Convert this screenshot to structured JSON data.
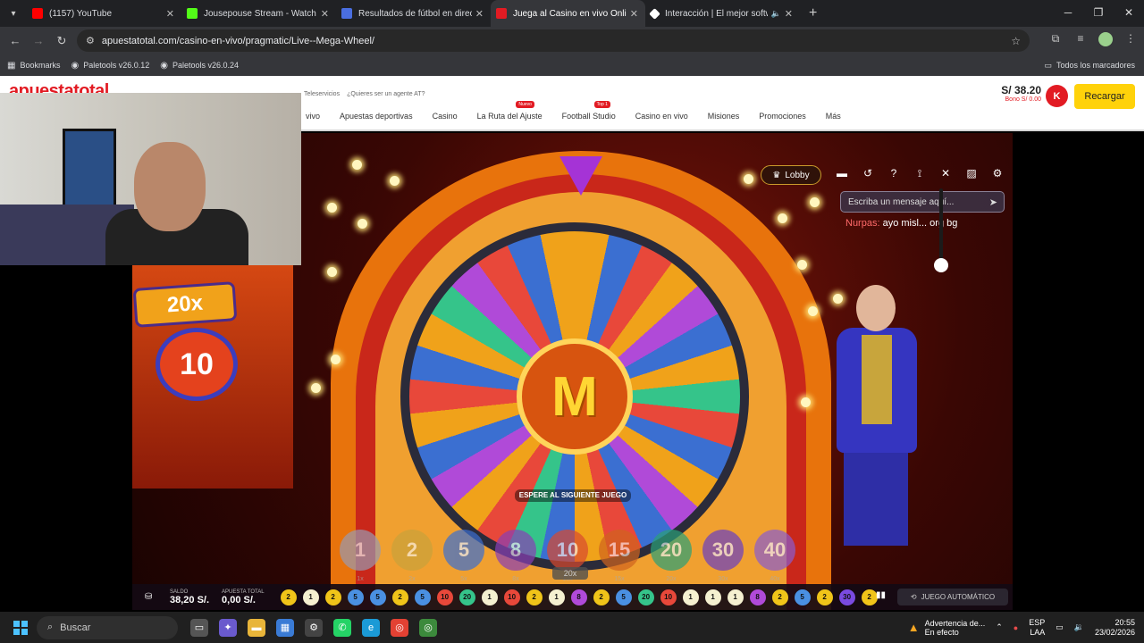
{
  "browser": {
    "tabs": [
      {
        "title": "(1157) YouTube",
        "color": "#ff0000",
        "active": false
      },
      {
        "title": "Jousepouse Stream - Watch Li...",
        "color": "#53fc18",
        "active": false
      },
      {
        "title": "Resultados de fútbol en directo",
        "color": "#4a6ee0",
        "active": false
      },
      {
        "title": "Juega al Casino en vivo Online",
        "color": "#e21b23",
        "active": true
      },
      {
        "title": "Interacción | El mejor softw...",
        "color": "#ffffff",
        "active": false
      }
    ],
    "url": "apuestatotal.com/casino-en-vivo/pragmatic/Live--Mega-Wheel/",
    "bookmarks": [
      "Bookmarks",
      "Paletools v26.0.12",
      "Paletools v26.0.24"
    ],
    "all_bookmarks": "Todos los marcadores"
  },
  "site": {
    "logo": "apuestatotal",
    "topline": [
      "Teleservicios",
      "¿Quieres ser un agente AT?"
    ],
    "nav": [
      {
        "label": "vivo",
        "badge": ""
      },
      {
        "label": "Apuestas deportivas",
        "badge": ""
      },
      {
        "label": "Casino",
        "badge": ""
      },
      {
        "label": "La Ruta del Ajuste",
        "badge": "Nuevo"
      },
      {
        "label": "Football Studio",
        "badge": "Top 1"
      },
      {
        "label": "Casino en vivo",
        "badge": ""
      },
      {
        "label": "Misiones",
        "badge": ""
      },
      {
        "label": "Promociones",
        "badge": ""
      },
      {
        "label": "Más",
        "badge": ""
      }
    ],
    "balance": "S/ 38.20",
    "bono": "Bono S/ 0.00",
    "avatar": "K",
    "recargar": "Recargar"
  },
  "game": {
    "lobby": "Lobby",
    "chat_placeholder": "Escriba un mensaje aquí...",
    "chat_user": "Nurpas:",
    "chat_text": "ayo misl... org bg",
    "status": "ESPERE AL SIGUIENTE JUEGO",
    "hub_letter": "M",
    "left_multiplier": "20x",
    "left_number": "10",
    "chips": [
      {
        "label": "1",
        "sub": "1x",
        "color": "#9a9ab0"
      },
      {
        "label": "2",
        "sub": "2x",
        "color": "#c9a23a"
      },
      {
        "label": "5",
        "sub": "5x",
        "color": "#3b6fd1"
      },
      {
        "label": "8",
        "sub": "8x",
        "color": "#8a3fb5"
      },
      {
        "label": "10",
        "sub": "10x",
        "color": "#d94a2e"
      },
      {
        "label": "15",
        "sub": "15x",
        "color": "#d0641e"
      },
      {
        "label": "20",
        "sub": "20x",
        "color": "#2aa178"
      },
      {
        "label": "30",
        "sub": "30x",
        "color": "#6a3fc2"
      },
      {
        "label": "40",
        "sub": "40x",
        "color": "#8a5dcf"
      }
    ],
    "selected_mult": "20x",
    "saldo_label": "SALDO",
    "saldo": "38,20 S/.",
    "apuesta_label": "APUESTA TOTAL",
    "apuesta": "0,00 S/.",
    "history": [
      {
        "n": "2",
        "c": "#f0c419"
      },
      {
        "n": "1",
        "c": "#f5f0d0"
      },
      {
        "n": "2",
        "c": "#f0c419"
      },
      {
        "n": "5",
        "c": "#4a90e2"
      },
      {
        "n": "5",
        "c": "#4a90e2"
      },
      {
        "n": "2",
        "c": "#f0c419"
      },
      {
        "n": "5",
        "c": "#4a90e2"
      },
      {
        "n": "10",
        "c": "#e8483a"
      },
      {
        "n": "20",
        "c": "#35c48a"
      },
      {
        "n": "1",
        "c": "#f5f0d0"
      },
      {
        "n": "10",
        "c": "#e8483a"
      },
      {
        "n": "2",
        "c": "#f0c419"
      },
      {
        "n": "1",
        "c": "#f5f0d0"
      },
      {
        "n": "8",
        "c": "#b04ad8"
      },
      {
        "n": "2",
        "c": "#f0c419"
      },
      {
        "n": "5",
        "c": "#4a90e2"
      },
      {
        "n": "20",
        "c": "#35c48a"
      },
      {
        "n": "10",
        "c": "#e8483a"
      },
      {
        "n": "1",
        "c": "#f5f0d0"
      },
      {
        "n": "1",
        "c": "#f5f0d0"
      },
      {
        "n": "1",
        "c": "#f5f0d0"
      },
      {
        "n": "8",
        "c": "#b04ad8"
      },
      {
        "n": "2",
        "c": "#f0c419"
      },
      {
        "n": "5",
        "c": "#4a90e2"
      },
      {
        "n": "2",
        "c": "#f0c419"
      },
      {
        "n": "30",
        "c": "#7a4ae0"
      },
      {
        "n": "2",
        "c": "#f0c419"
      }
    ],
    "autoplay": "JUEGO AUTOMÁTICO",
    "volume": 0.15
  },
  "taskbar": {
    "search": "Buscar",
    "warning_title": "Advertencia de...",
    "warning_sub": "En efecto",
    "lang": "ESP",
    "lang_sub": "LAA",
    "time": "20:55",
    "date": "23/02/2026"
  }
}
